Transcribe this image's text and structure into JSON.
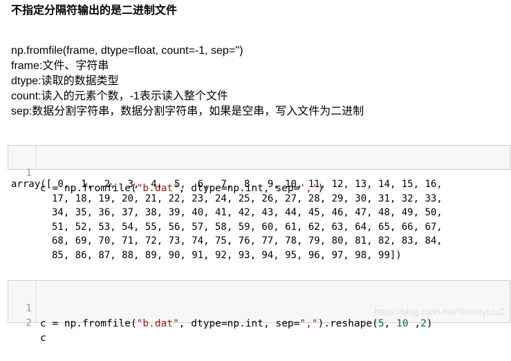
{
  "heading": "不指定分隔符输出的是二进制文件",
  "description": {
    "signature": "np.fromfile(frame, dtype=float, count=-1, sep='')",
    "frame": "frame:文件、字符串",
    "dtype": "dtype:读取的数据类型",
    "count": "count:读入的元素个数，-1表示读入整个文件",
    "sep": "sep:数据分割字符串，数据分割字符串，如果是空串，写入文件为二进制"
  },
  "cell1": {
    "line_number": "1",
    "code_prefix": "c = np.fromfile(",
    "code_str1": "\"b.dat\"",
    "code_mid": ", dtype=np.int, sep=",
    "code_str2": "','",
    "code_suffix": ")"
  },
  "output": {
    "lines": [
      "array([ 0,  1,  2,  3,  4,  5,  6,  7,  8,  9, 10, 11, 12, 13, 14, 15, 16,",
      "       17, 18, 19, 20, 21, 22, 23, 24, 25, 26, 27, 28, 29, 30, 31, 32, 33,",
      "       34, 35, 36, 37, 38, 39, 40, 41, 42, 43, 44, 45, 46, 47, 48, 49, 50,",
      "       51, 52, 53, 54, 55, 56, 57, 58, 59, 60, 61, 62, 63, 64, 65, 66, 67,",
      "       68, 69, 70, 71, 72, 73, 74, 75, 76, 77, 78, 79, 80, 81, 82, 83, 84,",
      "       85, 86, 87, 88, 89, 90, 91, 92, 93, 94, 95, 96, 97, 98, 99])"
    ]
  },
  "cell2": {
    "line1_number": "1",
    "line1_prefix": "c = np.fromfile(",
    "line1_str1": "\"b.dat\"",
    "line1_mid": ", dtype=np.int, sep=",
    "line1_str2": "\",\"",
    "line1_tail": ").reshape(",
    "line1_n1": "5",
    "line1_sep1": ", ",
    "line1_n2": "10",
    "line1_sep2": " ,",
    "line1_n3": "2",
    "line1_end": ")",
    "line2_number": "2",
    "line2_code": "c"
  },
  "watermark": "https://blog.csdn.net/TommyLiuZ"
}
